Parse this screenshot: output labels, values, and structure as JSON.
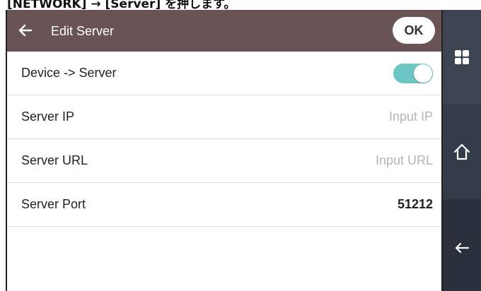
{
  "caption": "[NETWORK] → [Server] を押します。",
  "header": {
    "title": "Edit Server",
    "ok_label": "OK"
  },
  "rows": [
    {
      "label": "Device -> Server",
      "toggle_on": true
    },
    {
      "label": "Server IP",
      "placeholder": "Input IP",
      "value": ""
    },
    {
      "label": "Server URL",
      "placeholder": "Input URL",
      "value": ""
    },
    {
      "label": "Server Port",
      "value": "51212"
    }
  ],
  "sidebar": {
    "icons": [
      "grid-menu-icon",
      "home-icon",
      "back-arrow-icon"
    ]
  },
  "colors": {
    "header_bg": "#6a5354",
    "toggle_on": "#6cc6c6",
    "sidebar_bg": "#2f3440"
  }
}
